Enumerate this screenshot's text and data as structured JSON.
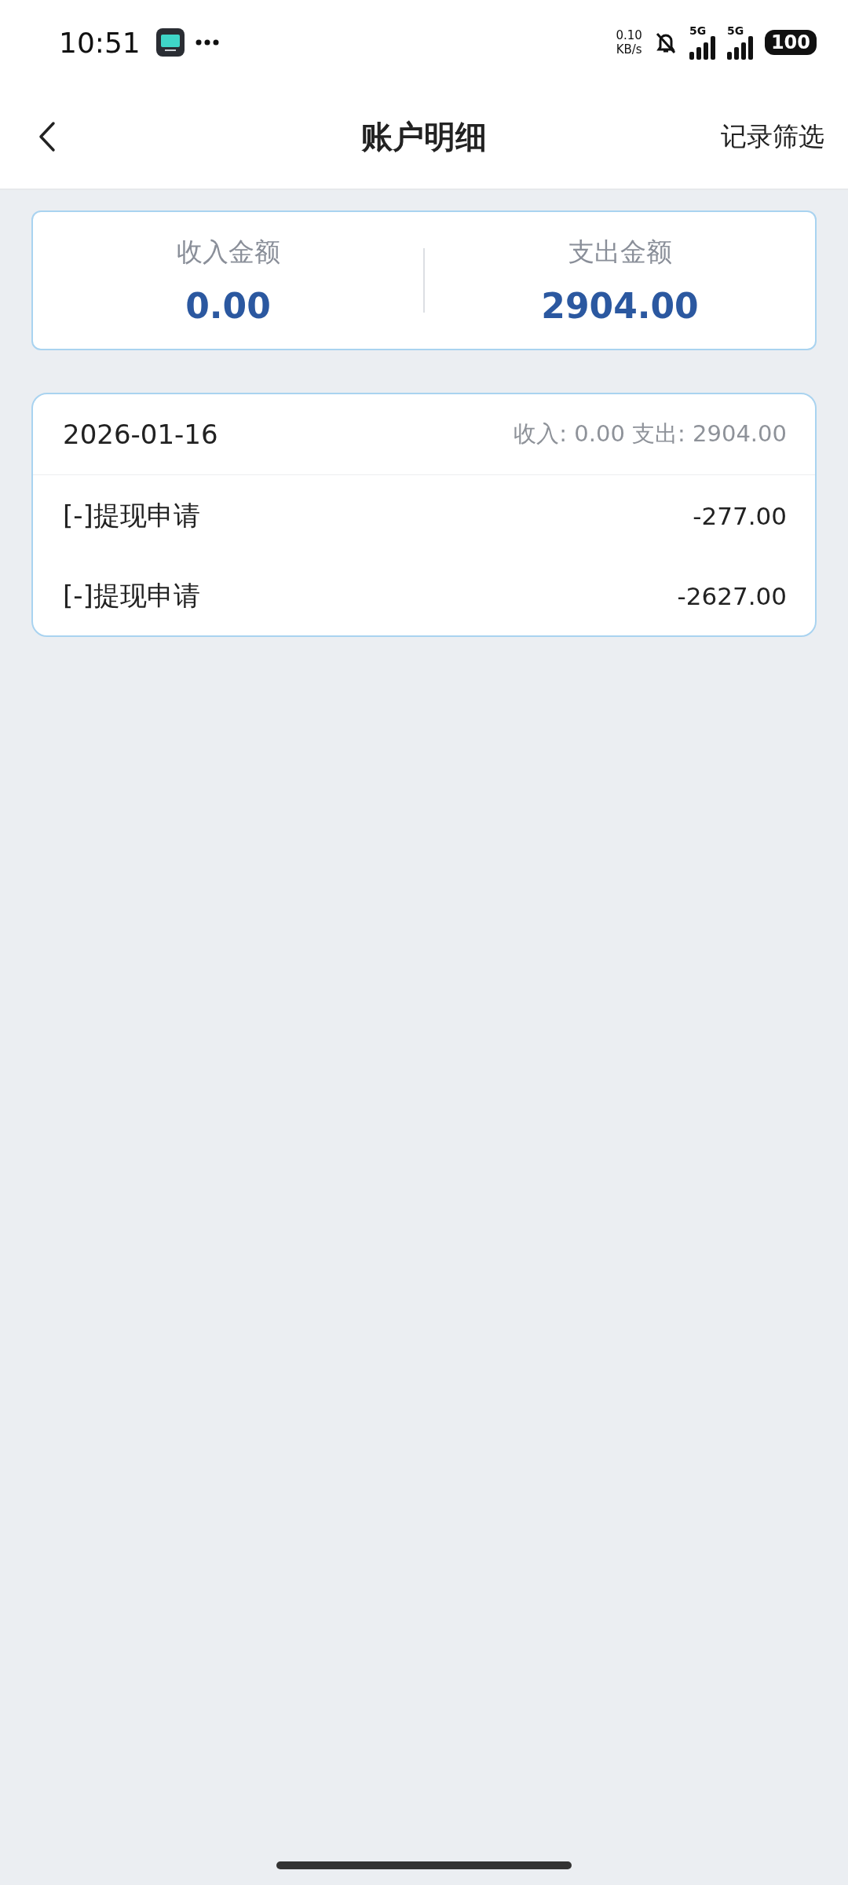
{
  "status_bar": {
    "time": "10:51",
    "net_speed": "0.10",
    "net_unit": "KB/s",
    "signals": [
      {
        "label": "5G"
      },
      {
        "label": "5G"
      }
    ],
    "battery": "100"
  },
  "header": {
    "title": "账户明细",
    "action": "记录筛选"
  },
  "summary": [
    {
      "label": "收入金额",
      "amount": "0.00"
    },
    {
      "label": "支出金额",
      "amount": "2904.00"
    }
  ],
  "groups": [
    {
      "date": "2026-01-16",
      "totals": "收入: 0.00 支出: 2904.00",
      "items": [
        {
          "title": "[-]提现申请",
          "amount": "-277.00"
        },
        {
          "title": "[-]提现申请",
          "amount": "-2627.00"
        }
      ]
    }
  ]
}
